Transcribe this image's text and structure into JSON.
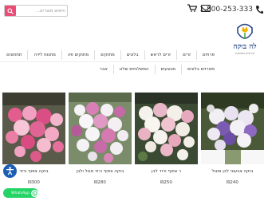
{
  "header": {
    "phone": "1-800-253-333",
    "phone_icon": "phone-icon",
    "mail_icon": "envelope-icon",
    "cart_icon": "cart-icon",
    "search_placeholder": "חיפוש מוצרים...",
    "search_icon": "search-icon"
  },
  "logo": {
    "name": "לה בוקה",
    "subtitle": "פרחים ומתנות",
    "icon": "tulip-logo-icon"
  },
  "nav": {
    "row1": [
      "פרחים",
      "זרים",
      "זרים לראש",
      "בלונים",
      "מתוקים",
      "מתוקים פינ",
      "מתנות לידה",
      "תחתונים"
    ],
    "row2": [
      "מארזים בלונים",
      "מבצעים",
      "המשלוחים שלנו",
      "אבר"
    ]
  },
  "products": [
    {
      "title": "בוקה צבעוני לבן וסגול",
      "price": "₪240"
    },
    {
      "title": "ר צפוף ורוד לבן",
      "price": "₪250"
    },
    {
      "title": "בוקה צפוף ורוד סגול ולבן",
      "price": "₪280"
    },
    {
      "title": "בוקה צפוף ורוד",
      "price": "₪300"
    }
  ],
  "widgets": {
    "accessibility_icon": "accessibility-icon",
    "whatsapp_label": "WhatsApp",
    "whatsapp_icon": "whatsapp-icon"
  },
  "colors": {
    "accent": "#e94e77",
    "brand_blue": "#2a4a86",
    "whatsapp": "#25d366",
    "accessibility": "#1b5fb4"
  }
}
